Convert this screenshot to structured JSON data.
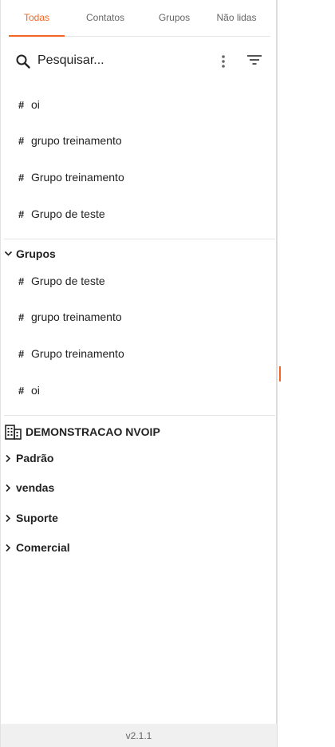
{
  "tabs": [
    {
      "label": "Todas",
      "active": true
    },
    {
      "label": "Contatos",
      "active": false
    },
    {
      "label": "Grupos",
      "active": false
    },
    {
      "label": "Não lidas",
      "active": false
    }
  ],
  "search": {
    "placeholder": "Pesquisar...",
    "icon": "search-icon",
    "menu_icon": "more-vert-icon",
    "filter_icon": "filter-icon"
  },
  "channels": [
    {
      "hash": "#",
      "name": "oi"
    },
    {
      "hash": "#",
      "name": "grupo treinamento"
    },
    {
      "hash": "#",
      "name": "Grupo treinamento"
    },
    {
      "hash": "#",
      "name": "Grupo de teste"
    }
  ],
  "groups_section": {
    "title": "Grupos",
    "expanded": true,
    "items": [
      {
        "hash": "#",
        "name": "Grupo de teste"
      },
      {
        "hash": "#",
        "name": "grupo treinamento"
      },
      {
        "hash": "#",
        "name": "Grupo treinamento"
      },
      {
        "hash": "#",
        "name": "oi"
      }
    ]
  },
  "organization": {
    "name": "DEMONSTRACAO NVOIP",
    "icon": "building-icon",
    "departments": [
      {
        "name": "Padrão",
        "expanded": false
      },
      {
        "name": "vendas",
        "expanded": false
      },
      {
        "name": "Suporte",
        "expanded": false
      },
      {
        "name": "Comercial",
        "expanded": false
      }
    ]
  },
  "footer": {
    "version": "v2.1.1"
  },
  "colors": {
    "accent": "#f26522",
    "divider": "#e4e4e4",
    "footer_bg": "#f0f0f0"
  }
}
